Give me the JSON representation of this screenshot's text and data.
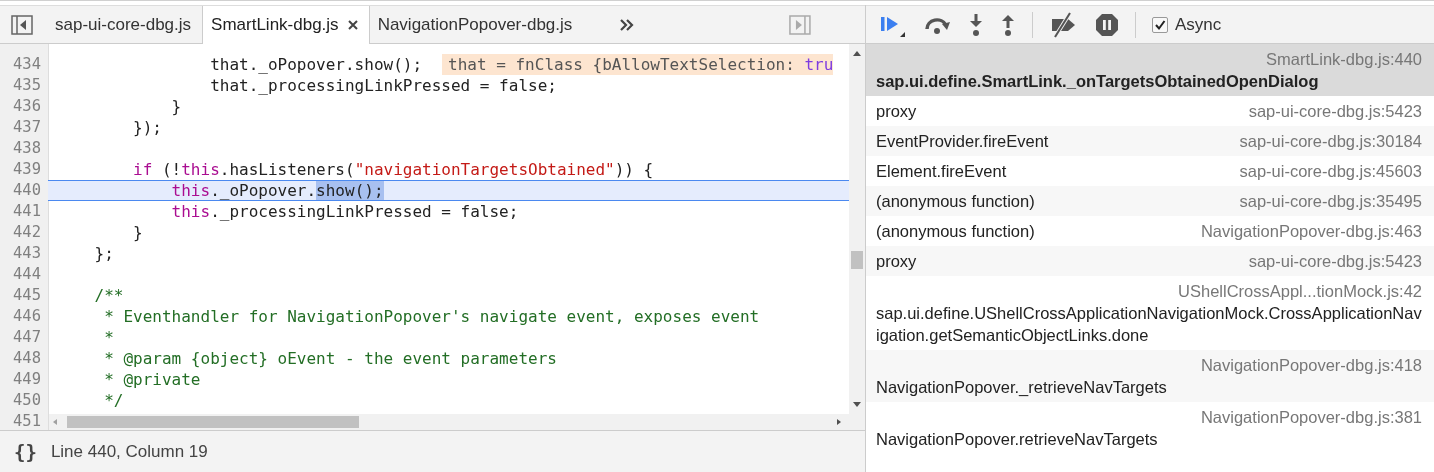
{
  "editor": {
    "tabs": [
      {
        "label": "sap-ui-core-dbg.js",
        "selected": false,
        "closable": false
      },
      {
        "label": "SmartLink-dbg.js",
        "selected": true,
        "closable": true
      },
      {
        "label": "NavigationPopover-dbg.js",
        "selected": false,
        "closable": false
      }
    ],
    "lines": [
      {
        "number": "434",
        "selected": false,
        "tokens": [
          {
            "kind": "plain",
            "text": "                that._oPopover.show();"
          },
          {
            "kind": "inline",
            "text": "that = fnClass {bAllowTextSelection: "
          },
          {
            "kind": "inline-literal",
            "text": "tru"
          }
        ]
      },
      {
        "number": "435",
        "selected": false,
        "tokens": [
          {
            "kind": "plain",
            "text": "                that._processingLinkPressed = false;"
          }
        ]
      },
      {
        "number": "436",
        "selected": false,
        "tokens": [
          {
            "kind": "plain",
            "text": "            }"
          }
        ]
      },
      {
        "number": "437",
        "selected": false,
        "tokens": [
          {
            "kind": "plain",
            "text": "        });"
          }
        ]
      },
      {
        "number": "438",
        "selected": false
      },
      {
        "number": "439",
        "selected": false,
        "tokens": [
          {
            "kind": "keyword",
            "text": "        if"
          },
          {
            "kind": "plain",
            "text": " (!"
          },
          {
            "kind": "keyword",
            "text": "this"
          },
          {
            "kind": "plain",
            "text": ".hasListeners("
          },
          {
            "kind": "string",
            "text": "\"navigationTargetsObtained\""
          },
          {
            "kind": "plain",
            "text": ")) {"
          }
        ]
      },
      {
        "number": "440",
        "selected": true,
        "tokens": [
          {
            "kind": "keyword",
            "text": "            this"
          },
          {
            "kind": "plain",
            "text": "._oPopover."
          },
          {
            "kind": "selection",
            "text": "show();"
          }
        ]
      },
      {
        "number": "441",
        "selected": false,
        "tokens": [
          {
            "kind": "keyword",
            "text": "            this"
          },
          {
            "kind": "plain",
            "text": "._processingLinkPressed = false;"
          }
        ]
      },
      {
        "number": "442",
        "selected": false,
        "tokens": [
          {
            "kind": "plain",
            "text": "        }"
          }
        ]
      },
      {
        "number": "443",
        "selected": false,
        "tokens": [
          {
            "kind": "plain",
            "text": "    };"
          }
        ]
      },
      {
        "number": "444",
        "selected": false
      },
      {
        "number": "445",
        "selected": false,
        "tokens": [
          {
            "kind": "comment",
            "text": "    /**"
          }
        ]
      },
      {
        "number": "446",
        "selected": false,
        "tokens": [
          {
            "kind": "comment",
            "text": "     * Eventhandler for NavigationPopover's navigate event, exposes event"
          }
        ]
      },
      {
        "number": "447",
        "selected": false,
        "tokens": [
          {
            "kind": "comment",
            "text": "     *"
          }
        ]
      },
      {
        "number": "448",
        "selected": false,
        "tokens": [
          {
            "kind": "comment",
            "text": "     * @param {object} oEvent - the event parameters"
          }
        ]
      },
      {
        "number": "449",
        "selected": false,
        "tokens": [
          {
            "kind": "comment",
            "text": "     * @private"
          }
        ]
      },
      {
        "number": "450",
        "selected": false,
        "tokens": [
          {
            "kind": "comment",
            "text": "     */"
          }
        ]
      },
      {
        "number": "451",
        "selected": false
      }
    ]
  },
  "status_bar": {
    "pretty_print": "{}",
    "position": "Line 440, Column 19"
  },
  "debugger": {
    "async": {
      "label": "Async",
      "checked": true
    },
    "call_stack": [
      {
        "function": "sap.ui.define.SmartLink._onTargetsObtainedOpenDialog",
        "location": "SmartLink-dbg.js:440",
        "selected": true
      },
      {
        "function": "proxy",
        "location": "sap-ui-core-dbg.js:5423",
        "selected": false
      },
      {
        "function": "EventProvider.fireEvent",
        "location": "sap-ui-core-dbg.js:30184",
        "selected": false
      },
      {
        "function": "Element.fireEvent",
        "location": "sap-ui-core-dbg.js:45603",
        "selected": false
      },
      {
        "function": "(anonymous function)",
        "location": "sap-ui-core-dbg.js:35495",
        "selected": false
      },
      {
        "function": "(anonymous function)",
        "location": "NavigationPopover-dbg.js:463",
        "selected": false
      },
      {
        "function": "proxy",
        "location": "sap-ui-core-dbg.js:5423",
        "selected": false
      },
      {
        "function": "sap.ui.define.UShellCrossApplicationNavigationMock.CrossApplicationNavigation.getSemanticObjectLinks.done",
        "location": "UShellCrossAppl...tionMock.js:42",
        "selected": false
      },
      {
        "function": "NavigationPopover._retrieveNavTargets",
        "location": "NavigationPopover-dbg.js:418",
        "selected": false
      },
      {
        "function": "NavigationPopover.retrieveNavTargets",
        "location": "NavigationPopover-dbg.js:381",
        "selected": false
      }
    ]
  }
}
